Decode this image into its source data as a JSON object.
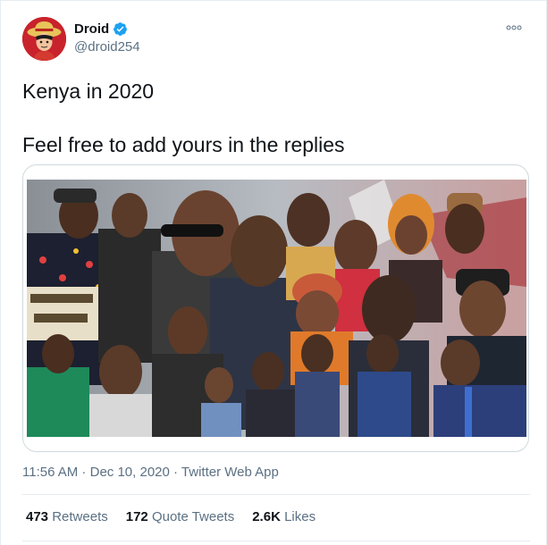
{
  "author": {
    "display_name": "Droid",
    "handle": "@droid254",
    "verified_icon": "verified-badge-icon",
    "avatar_icon": "avatar-icon"
  },
  "tweet": {
    "line1": "Kenya in 2020",
    "line2": "Feel free to add yours in the replies"
  },
  "meta": {
    "time": "11:56 AM",
    "separator1": " · ",
    "date": "Dec 10, 2020",
    "separator2": " · ",
    "source": "Twitter Web App"
  },
  "stats": {
    "retweets_count": "473",
    "retweets_label": "Retweets",
    "quotes_count": "172",
    "quotes_label": "Quote Tweets",
    "likes_count": "2.6K",
    "likes_label": "Likes"
  },
  "colors": {
    "verified": "#1da1f2",
    "secondary_text": "#5b7083",
    "avatar_bg": "#c8232c"
  },
  "icons": {
    "more": "more-options-icon"
  }
}
